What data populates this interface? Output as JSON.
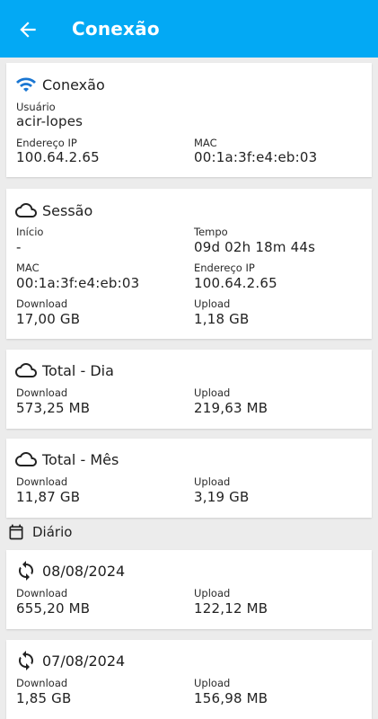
{
  "appbar": {
    "title": "Conexão"
  },
  "connection": {
    "title": "Conexão",
    "user_label": "Usuário",
    "user_value": "acir-lopes",
    "ip_label": "Endereço IP",
    "ip_value": "100.64.2.65",
    "mac_label": "MAC",
    "mac_value": "00:1a:3f:e4:eb:03"
  },
  "session": {
    "title": "Sessão",
    "start_label": "Início",
    "start_value": "-",
    "time_label": "Tempo",
    "time_value": "09d 02h 18m 44s",
    "mac_label": "MAC",
    "mac_value": "00:1a:3f:e4:eb:03",
    "ip_label": "Endereço IP",
    "ip_value": "100.64.2.65",
    "download_label": "Download",
    "download_value": "17,00 GB",
    "upload_label": "Upload",
    "upload_value": "1,18 GB"
  },
  "total_day": {
    "title": "Total - Dia",
    "download_label": "Download",
    "download_value": "573,25 MB",
    "upload_label": "Upload",
    "upload_value": "219,63 MB"
  },
  "total_month": {
    "title": "Total - Mês",
    "download_label": "Download",
    "download_value": "11,87 GB",
    "upload_label": "Upload",
    "upload_value": "3,19 GB"
  },
  "daily": {
    "title": "Diário",
    "days": [
      {
        "date": "08/08/2024",
        "download_label": "Download",
        "download_value": "655,20 MB",
        "upload_label": "Upload",
        "upload_value": "122,12 MB"
      },
      {
        "date": "07/08/2024",
        "download_label": "Download",
        "download_value": "1,85 GB",
        "upload_label": "Upload",
        "upload_value": "156,98 MB"
      }
    ]
  },
  "colors": {
    "appbar": "#03a9f4",
    "wifi_icon": "#1976d2"
  },
  "icons": {
    "back": "arrow-left-icon",
    "wifi": "wifi-icon",
    "cloud": "cloud-icon",
    "calendar": "calendar-icon",
    "sync": "sync-icon"
  }
}
